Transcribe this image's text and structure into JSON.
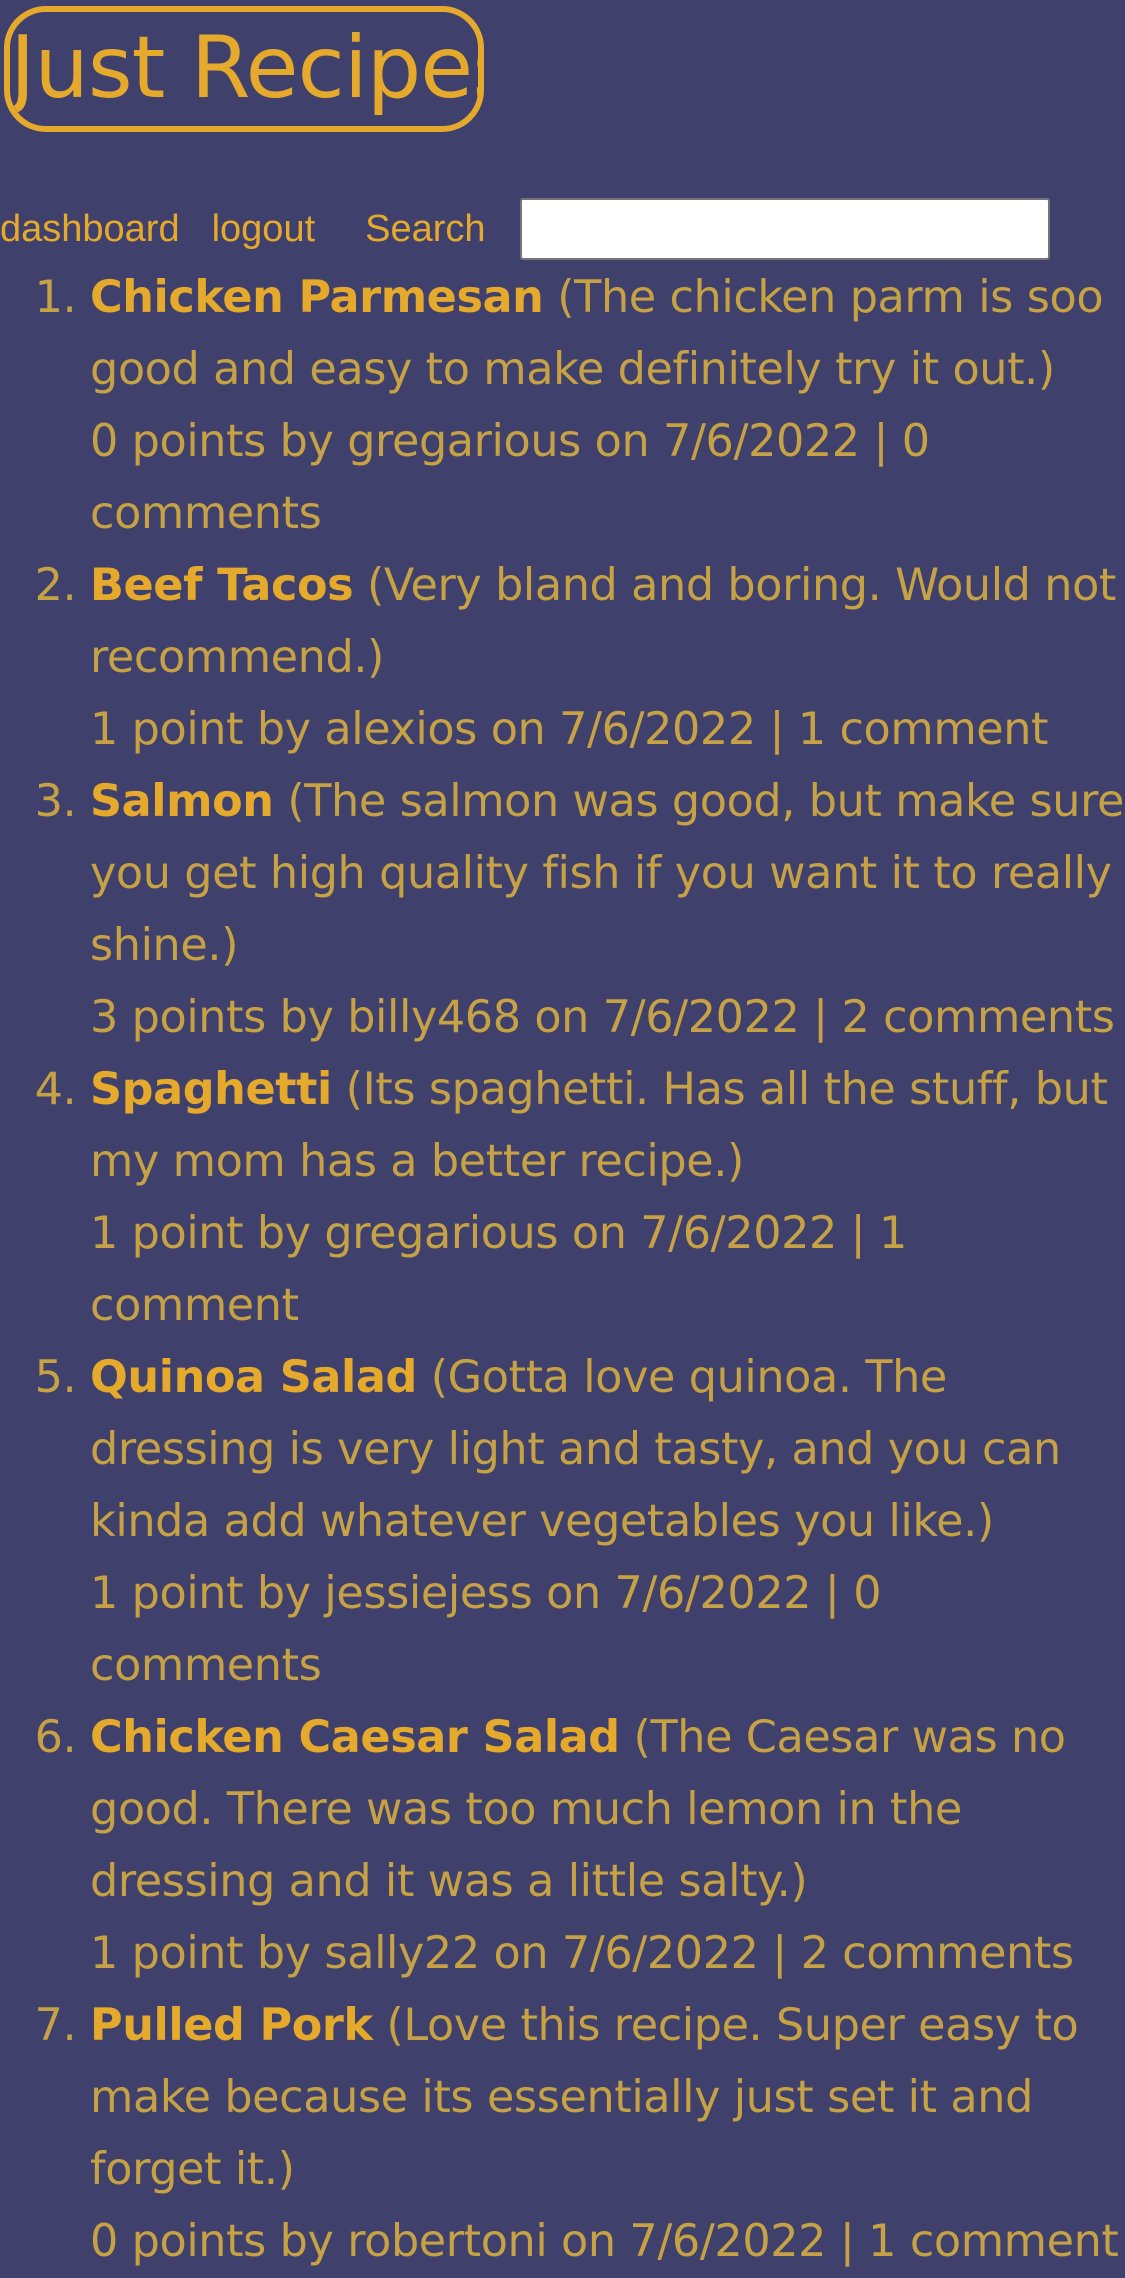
{
  "site": {
    "logo": "Just Recipes"
  },
  "nav": {
    "dashboard": "dashboard",
    "logout": "logout",
    "search_label": "Search",
    "search_value": ""
  },
  "recipes": [
    {
      "title": "Chicken Parmesan",
      "description": "(The chicken parm is soo good and easy to make definitely try it out.)",
      "meta": "0 points by gregarious on 7/6/2022 | 0 comments"
    },
    {
      "title": "Beef Tacos",
      "description": "(Very bland and boring. Would not recommend.)",
      "meta": "1 point by alexios on 7/6/2022 | 1 comment"
    },
    {
      "title": "Salmon",
      "description": "(The salmon was good, but make sure you get high quality fish if you want it to really shine.)",
      "meta": "3 points by billy468 on 7/6/2022 | 2 comments"
    },
    {
      "title": "Spaghetti",
      "description": "(Its spaghetti. Has all the stuff, but my mom has a better recipe.)",
      "meta": "1 point by gregarious on 7/6/2022 | 1 comment"
    },
    {
      "title": "Quinoa Salad",
      "description": "(Gotta love quinoa. The dressing is very light and tasty, and you can kinda add whatever vegetables you like.)",
      "meta": "1 point by jessiejess on 7/6/2022 | 0 comments"
    },
    {
      "title": "Chicken Caesar Salad",
      "description": "(The Caesar was no good. There was too much lemon in the dressing and it was a little salty.)",
      "meta": "1 point by sally22 on 7/6/2022 | 2 comments"
    },
    {
      "title": "Pulled Pork",
      "description": "(Love this recipe. Super easy to make because its essentially just set it and forget it.)",
      "meta": "0 points by robertoni on 7/6/2022 | 1 comment"
    }
  ],
  "colors": {
    "background": "#3f416c",
    "accent": "#e5a92b",
    "text": "#c6a245"
  }
}
